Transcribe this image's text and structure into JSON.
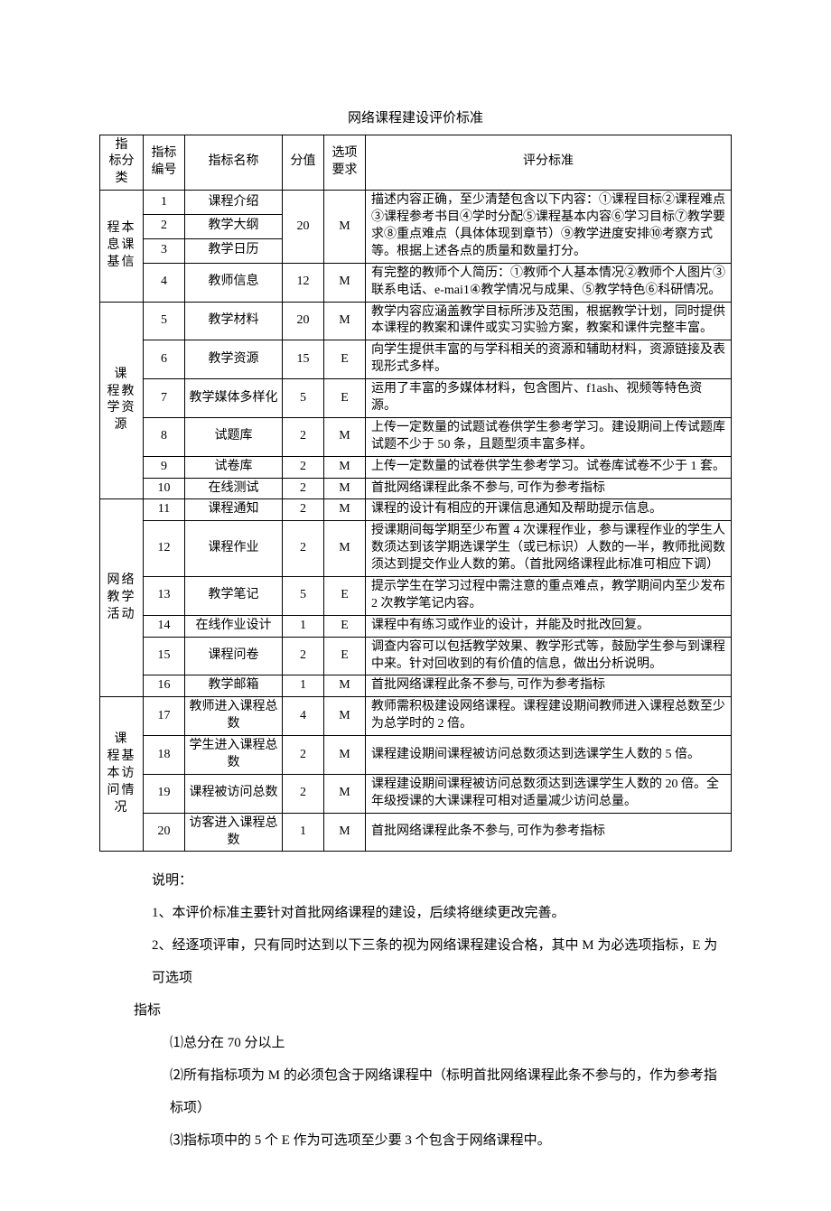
{
  "title": "网络课程建设评价标准",
  "headers": {
    "category": "指　标分类",
    "num": "指标编号",
    "name": "指标名称",
    "score": "分值",
    "opt": "选项要求",
    "criteria": "评分标准"
  },
  "groups": [
    {
      "label": "程本息课基信",
      "rows": [
        {
          "num": "1",
          "name": "课程介绍",
          "score": "20",
          "opt": "M",
          "score_rowspan": 3,
          "opt_rowspan": 3,
          "crit": "描述内容正确，至少清楚包含以下内容：①课程目标②课程难点③课程参考书目④学时分配⑤课程基本内容⑥学习目标⑦教学要求⑧重点难点（具体体现到章节）⑨教学进度安排⑩考察方式等。根据上述各点的质量和数量打分。",
          "crit_rowspan": 3
        },
        {
          "num": "2",
          "name": "教学大纲"
        },
        {
          "num": "3",
          "name": "教学日历"
        },
        {
          "num": "4",
          "name": "教师信息",
          "score": "12",
          "opt": "M",
          "crit": "有完整的教师个人简历：①教师个人基本情况②教师个人图片③联系电话、e-mai1④教学情况与成果、⑤教学特色⑥科研情况。"
        }
      ]
    },
    {
      "label": "课　程教学资源",
      "rows": [
        {
          "num": "5",
          "name": "教学材料",
          "score": "20",
          "opt": "M",
          "crit": "教学内容应涵盖教学目标所涉及范围，根据教学计划，同时提供本课程的教案和课件或实习实验方案，教案和课件完整丰富。"
        },
        {
          "num": "6",
          "name": "教学资源",
          "score": "15",
          "opt": "E",
          "crit": "向学生提供丰富的与学科相关的资源和辅助材料，资源链接及表现形式多样。"
        },
        {
          "num": "7",
          "name": "教学媒体多样化",
          "score": "5",
          "opt": "E",
          "crit": "运用了丰富的多媒体材料，包含图片、f1ash、视频等特色资源。"
        },
        {
          "num": "8",
          "name": "试题库",
          "score": "2",
          "opt": "M",
          "crit": "上传一定数量的试题试卷供学生参考学习。建设期间上传试题库试题不少于 50 条，且题型须丰富多样。"
        },
        {
          "num": "9",
          "name": "试卷库",
          "score": "2",
          "opt": "M",
          "crit": "上传一定数量的试卷供学生参考学习。试卷库试卷不少于 1 套。"
        },
        {
          "num": "10",
          "name": "在线测试",
          "score": "2",
          "opt": "M",
          "crit": "首批网络课程此条不参与, 可作为参考指标"
        }
      ]
    },
    {
      "label": "网络教学活动",
      "rows": [
        {
          "num": "11",
          "name": "课程通知",
          "score": "2",
          "opt": "M",
          "crit": "课程的设计有相应的开课信息通知及帮助提示信息。"
        },
        {
          "num": "12",
          "name": "课程作业",
          "score": "2",
          "opt": "M",
          "crit": "授课期间每学期至少布置 4 次课程作业，参与课程作业的学生人数须达到该学期选课学生（或已标识）人数的一半，教师批阅数须达到提交作业人数的第。（首批网络课程此标准可相应下调）"
        },
        {
          "num": "13",
          "name": "教学笔记",
          "score": "5",
          "opt": "E",
          "crit": "提示学生在学习过程中需注意的重点难点，教学期间内至少发布 2 次教学笔记内容。"
        },
        {
          "num": "14",
          "name": "在线作业设计",
          "score": "1",
          "opt": "E",
          "crit": "课程中有练习或作业的设计，并能及时批改回复。"
        },
        {
          "num": "15",
          "name": "课程问卷",
          "score": "2",
          "opt": "E",
          "crit": "调查内容可以包括教学效果、教学形式等，鼓励学生参与到课程中来。针对回收到的有价值的信息，做出分析说明。"
        },
        {
          "num": "16",
          "name": "教学邮箱",
          "score": "1",
          "opt": "M",
          "crit": "首批网络课程此条不参与, 可作为参考指标"
        }
      ]
    },
    {
      "label": "课　程基本访问情况",
      "rows": [
        {
          "num": "17",
          "name": "教师进入课程总数",
          "score": "4",
          "opt": "M",
          "crit": "教师需积极建设网络课程。课程建设期间教师进入课程总数至少为总学时的 2 倍。"
        },
        {
          "num": "18",
          "name": "学生进入课程总数",
          "score": "2",
          "opt": "M",
          "crit": "课程建设期间课程被访问总数须达到选课学生人数的 5 倍。"
        },
        {
          "num": "19",
          "name": "课程被访问总数",
          "score": "2",
          "opt": "M",
          "crit": "课程建设期间课程被访问总数须达到选课学生人数的 20 倍。全年级授课的大课课程可相对适量减少访问总量。"
        },
        {
          "num": "20",
          "name": "访客进入课程总数",
          "score": "1",
          "opt": "M",
          "crit": "首批网络课程此条不参与, 可作为参考指标"
        }
      ]
    }
  ],
  "notes": {
    "p0": "说明：",
    "p1": "1、本评价标准主要针对首批网络课程的建设，后续将继续更改完善。",
    "p2": "2、经逐项评审，只有同时达到以下三条的视为网络课程建设合格，其中 M 为必选项指标，E 为可选项",
    "p2b": "指标",
    "p3": "⑴总分在 70 分以上",
    "p4": "⑵所有指标项为 M 的必须包含于网络课程中（标明首批网络课程此条不参与的，作为参考指标项）",
    "p5": "⑶指标项中的 5 个 E 作为可选项至少要 3 个包含于网络课程中。"
  }
}
